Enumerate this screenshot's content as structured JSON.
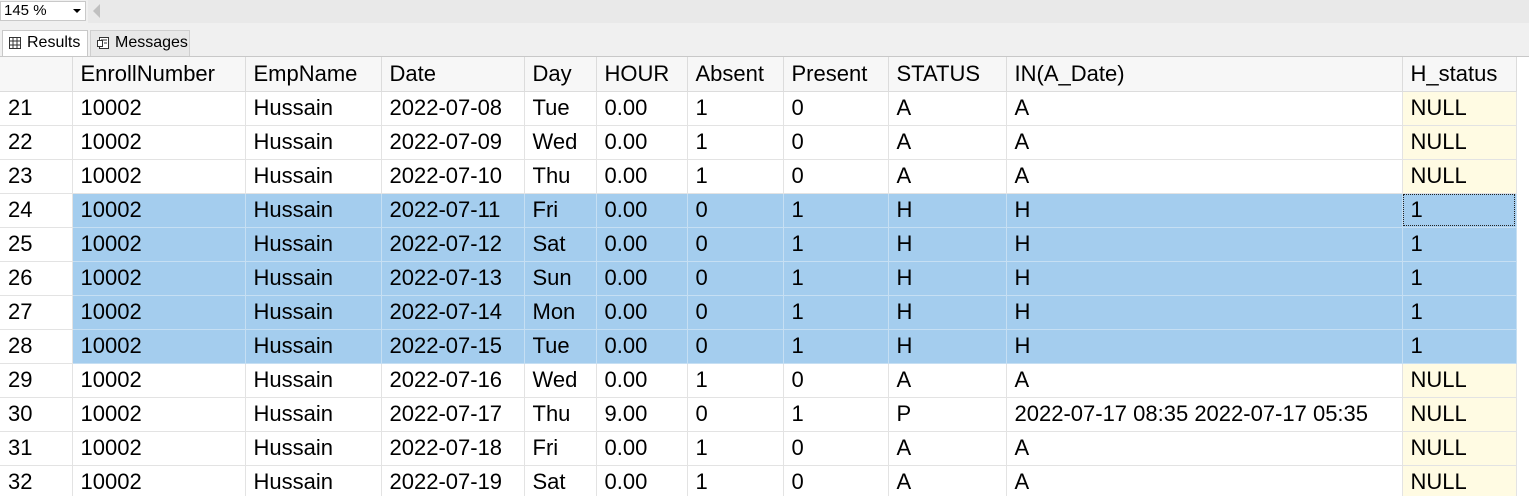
{
  "toolbar": {
    "zoom": "145 %"
  },
  "tabs": {
    "results": "Results",
    "messages": "Messages"
  },
  "grid": {
    "columns": [
      "",
      "EnrollNumber",
      "EmpName",
      "Date",
      "Day",
      "HOUR",
      "Absent",
      "Present",
      "STATUS",
      "IN(A_Date)",
      "H_status"
    ],
    "selection_color": "#a4cdee",
    "hstatus_bg": "#fffbe3",
    "rows": [
      {
        "n": "21",
        "enroll": "10002",
        "name": "Hussain",
        "date": "2022-07-08",
        "day": "Tue",
        "hour": "0.00",
        "absent": "1",
        "present": "0",
        "status": "A",
        "in": "A",
        "hs": "NULL",
        "selected": false
      },
      {
        "n": "22",
        "enroll": "10002",
        "name": "Hussain",
        "date": "2022-07-09",
        "day": "Wed",
        "hour": "0.00",
        "absent": "1",
        "present": "0",
        "status": "A",
        "in": "A",
        "hs": "NULL",
        "selected": false
      },
      {
        "n": "23",
        "enroll": "10002",
        "name": "Hussain",
        "date": "2022-07-10",
        "day": "Thu",
        "hour": "0.00",
        "absent": "1",
        "present": "0",
        "status": "A",
        "in": "A",
        "hs": "NULL",
        "selected": false
      },
      {
        "n": "24",
        "enroll": "10002",
        "name": "Hussain",
        "date": "2022-07-11",
        "day": "Fri",
        "hour": "0.00",
        "absent": "0",
        "present": "1",
        "status": "H",
        "in": "H",
        "hs": "1",
        "selected": true
      },
      {
        "n": "25",
        "enroll": "10002",
        "name": "Hussain",
        "date": "2022-07-12",
        "day": "Sat",
        "hour": "0.00",
        "absent": "0",
        "present": "1",
        "status": "H",
        "in": "H",
        "hs": "1",
        "selected": true
      },
      {
        "n": "26",
        "enroll": "10002",
        "name": "Hussain",
        "date": "2022-07-13",
        "day": "Sun",
        "hour": "0.00",
        "absent": "0",
        "present": "1",
        "status": "H",
        "in": "H",
        "hs": "1",
        "selected": true
      },
      {
        "n": "27",
        "enroll": "10002",
        "name": "Hussain",
        "date": "2022-07-14",
        "day": "Mon",
        "hour": "0.00",
        "absent": "0",
        "present": "1",
        "status": "H",
        "in": "H",
        "hs": "1",
        "selected": true
      },
      {
        "n": "28",
        "enroll": "10002",
        "name": "Hussain",
        "date": "2022-07-15",
        "day": "Tue",
        "hour": "0.00",
        "absent": "0",
        "present": "1",
        "status": "H",
        "in": "H",
        "hs": "1",
        "selected": true
      },
      {
        "n": "29",
        "enroll": "10002",
        "name": "Hussain",
        "date": "2022-07-16",
        "day": "Wed",
        "hour": "0.00",
        "absent": "1",
        "present": "0",
        "status": "A",
        "in": "A",
        "hs": "NULL",
        "selected": false
      },
      {
        "n": "30",
        "enroll": "10002",
        "name": "Hussain",
        "date": "2022-07-17",
        "day": "Thu",
        "hour": "9.00",
        "absent": "0",
        "present": "1",
        "status": "P",
        "in": "2022-07-17 08:35 2022-07-17 05:35",
        "hs": "NULL",
        "selected": false
      },
      {
        "n": "31",
        "enroll": "10002",
        "name": "Hussain",
        "date": "2022-07-18",
        "day": "Fri",
        "hour": "0.00",
        "absent": "1",
        "present": "0",
        "status": "A",
        "in": "A",
        "hs": "NULL",
        "selected": false
      },
      {
        "n": "32",
        "enroll": "10002",
        "name": "Hussain",
        "date": "2022-07-19",
        "day": "Sat",
        "hour": "0.00",
        "absent": "1",
        "present": "0",
        "status": "A",
        "in": "A",
        "hs": "NULL",
        "selected": false
      }
    ]
  }
}
